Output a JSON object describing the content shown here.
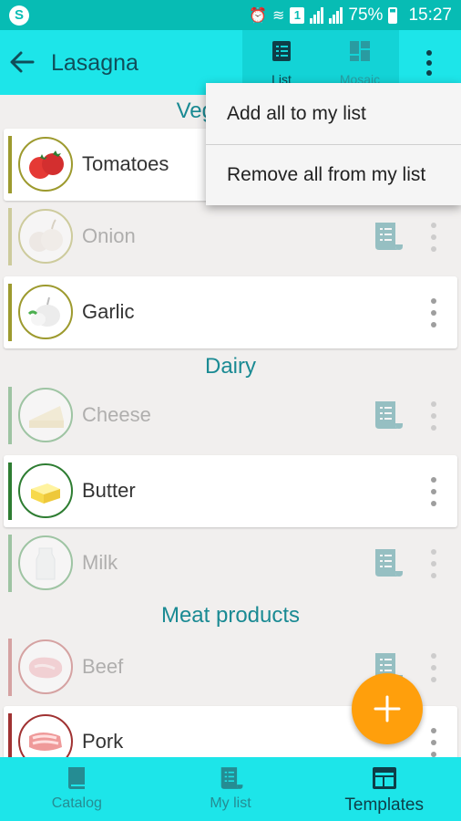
{
  "status_bar": {
    "battery": "75%",
    "time": "15:27",
    "sim_badge": "1"
  },
  "app_bar": {
    "title": "Lasagna",
    "view_list_label": "List",
    "view_mosaic_label": "Mosaic"
  },
  "sections": [
    {
      "title": "Vegetables"
    },
    {
      "title": "Dairy"
    },
    {
      "title": "Meat products"
    }
  ],
  "items": [
    {
      "name": "Tomatoes",
      "accent": "#9d9a2e"
    },
    {
      "name": "Onion",
      "accent": "#9d9a2e"
    },
    {
      "name": "Garlic",
      "accent": "#9d9a2e"
    },
    {
      "name": "Cheese",
      "accent": "#2e8b3d"
    },
    {
      "name": "Butter",
      "accent": "#2e7d32"
    },
    {
      "name": "Milk",
      "accent": "#2e8b3d"
    },
    {
      "name": "Beef",
      "accent": "#b03a3a"
    },
    {
      "name": "Pork",
      "accent": "#a03232"
    }
  ],
  "menu": {
    "add_all": "Add all to my list",
    "remove_all": "Remove all from my list"
  },
  "bottom_nav": {
    "catalog": "Catalog",
    "my_list": "My list",
    "templates": "Templates"
  },
  "colors": {
    "primary": "#1de5e9",
    "status": "#07bcb4",
    "header_text": "#1a8a93",
    "fab": "#ff9f0c"
  }
}
